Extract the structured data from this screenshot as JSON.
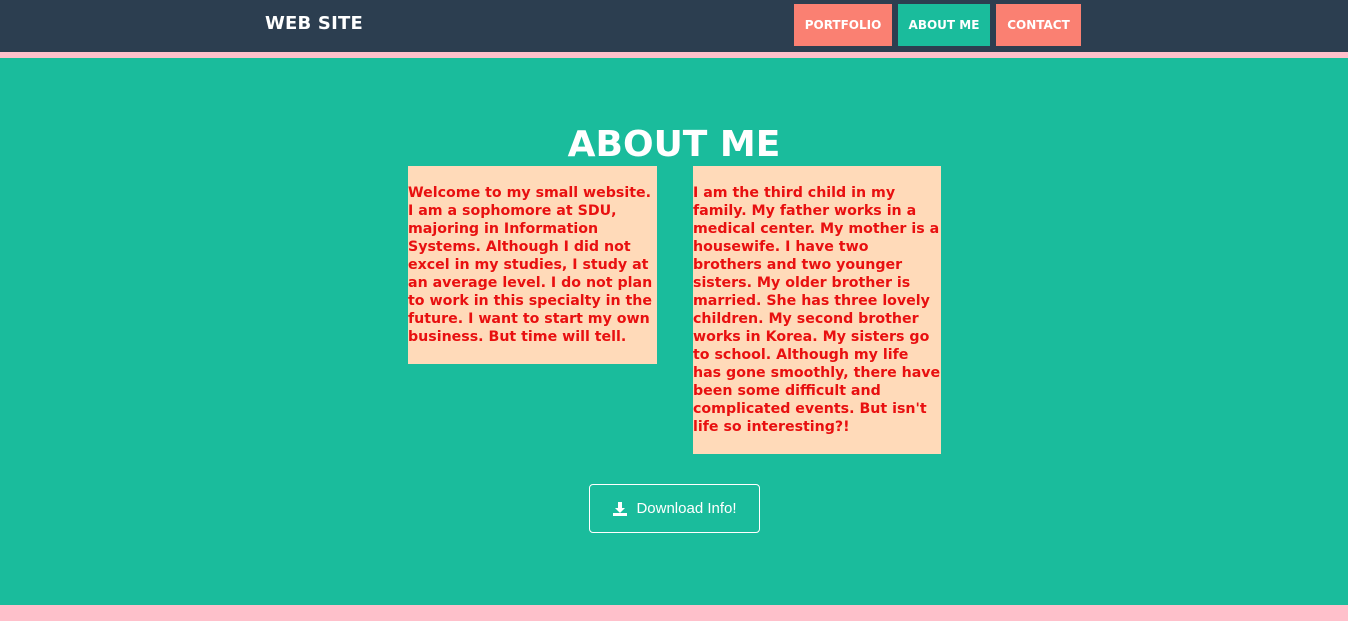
{
  "navbar": {
    "brand": "WEB SITE",
    "items": [
      {
        "label": "PORTFOLIO"
      },
      {
        "label": "ABOUT ME"
      },
      {
        "label": "CONTACT"
      }
    ]
  },
  "main": {
    "title": "ABOUT ME",
    "cards": [
      {
        "text": "Welcome to my small website. I am a sophomore at SDU, majoring in Information Systems. Although I did not excel in my studies, I study at an average level. I do not plan to work in this specialty in the future. I want to start my own business. But time will tell."
      },
      {
        "text": "I am the third child in my family. My father works in a medical center. My mother is a housewife. I have two brothers and two younger sisters. My older brother is married. She has three lovely children. My second brother works in Korea. My sisters go to school. Although my life has gone smoothly, there have been some difficult and complicated events. But isn't life so interesting?!"
      }
    ],
    "download_button": {
      "label": "Download Info!",
      "icon": "download-icon"
    }
  },
  "colors": {
    "navbar_bg": "#2c3e50",
    "section_bg": "#1abc9c",
    "accent_salmon": "#fa8072",
    "card_bg": "#ffdab9",
    "card_text": "#e81010",
    "border_pink": "#ffc0cb"
  }
}
